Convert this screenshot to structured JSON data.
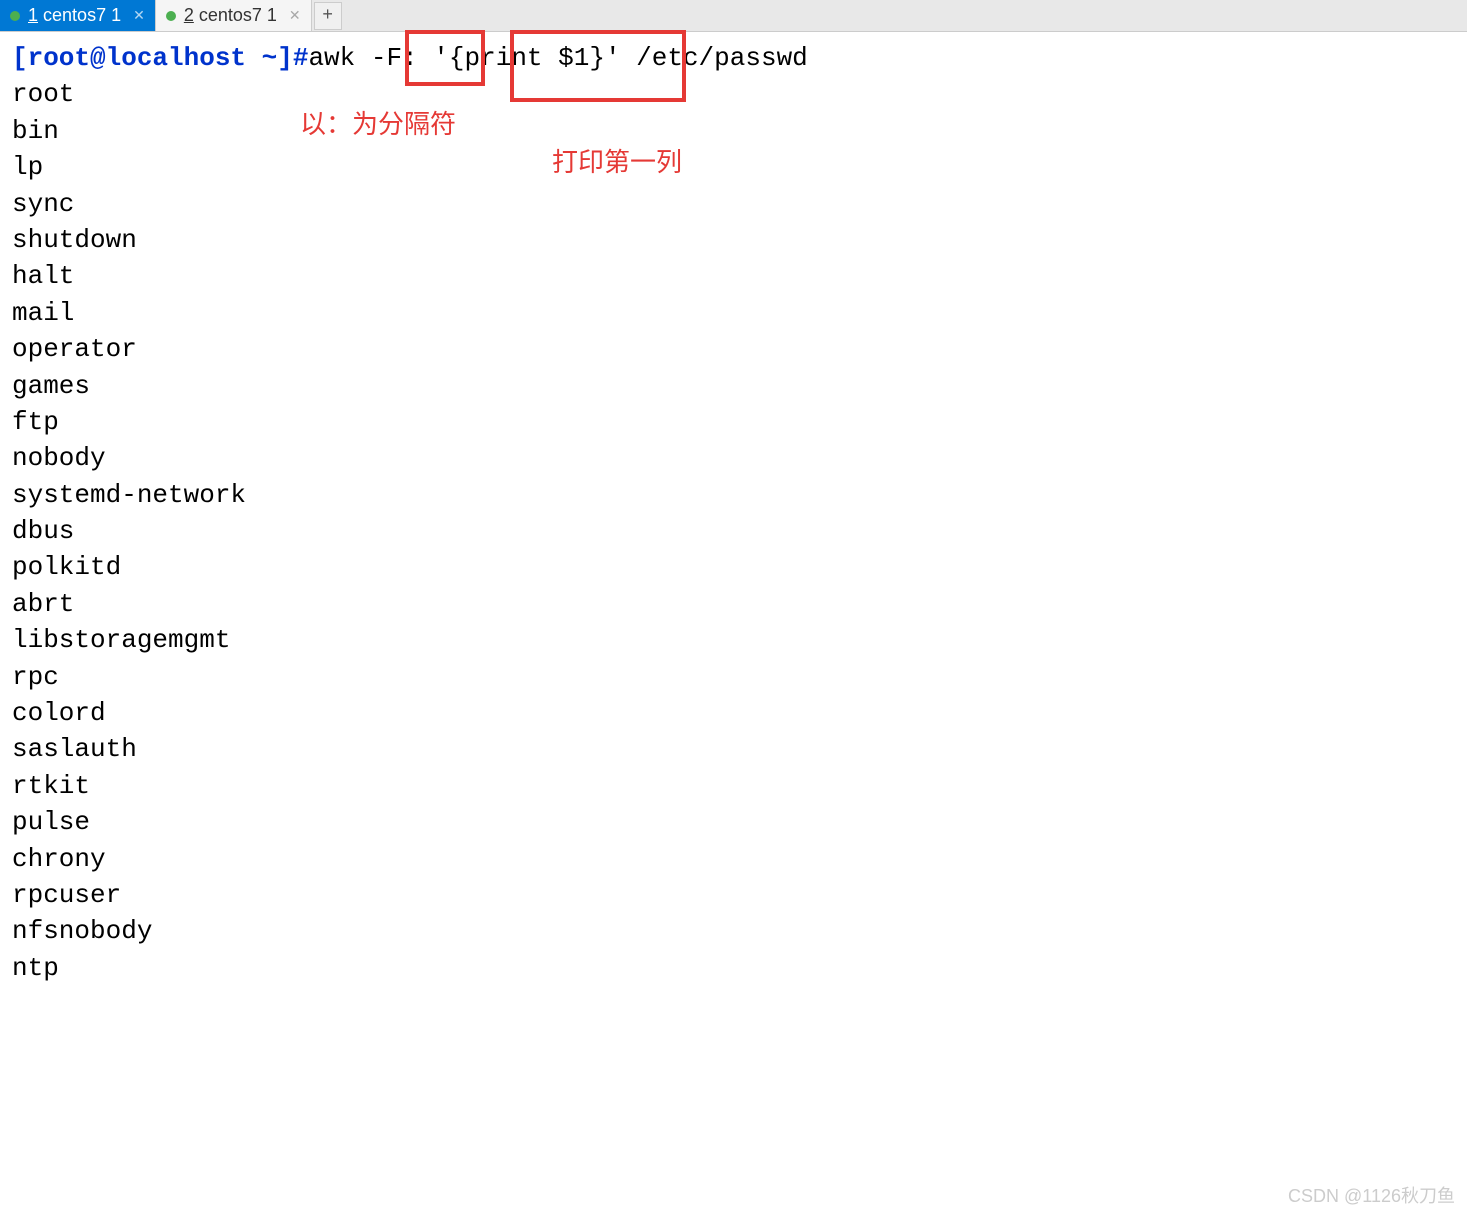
{
  "tabs": [
    {
      "num": "1",
      "label": "centos7 1",
      "active": true
    },
    {
      "num": "2",
      "label": "centos7 1",
      "active": false
    }
  ],
  "newTab": "+",
  "terminal": {
    "prompt": "[root@localhost ~]#",
    "cmd_part1": "awk ",
    "cmd_part2": "-F:",
    "cmd_part3": " '",
    "cmd_part4": "{print $1}",
    "cmd_part5": "' /etc/passwd",
    "output": [
      "root",
      "bin",
      "lp",
      "sync",
      "shutdown",
      "halt",
      "mail",
      "operator",
      "games",
      "ftp",
      "nobody",
      "systemd-network",
      "dbus",
      "polkitd",
      "abrt",
      "libstoragemgmt",
      "rpc",
      "colord",
      "saslauth",
      "rtkit",
      "pulse",
      "chrony",
      "rpcuser",
      "nfsnobody",
      "ntp"
    ]
  },
  "annotations": {
    "box1_label": "以：为分隔符",
    "box2_label": "打印第一列"
  },
  "watermark": "CSDN @1126秋刀鱼"
}
